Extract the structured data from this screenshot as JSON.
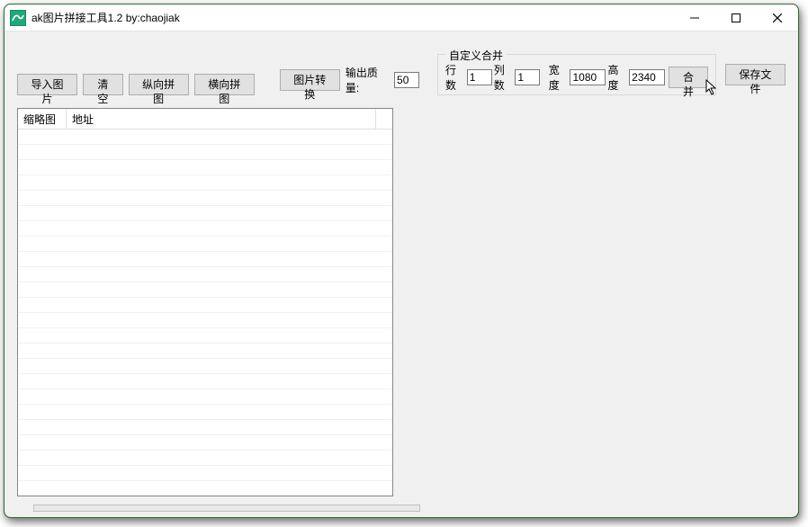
{
  "window": {
    "title": "ak图片拼接工具1.2  by:chaojiak"
  },
  "toolbar": {
    "import_label": "导入图片",
    "clear_label": "清空",
    "vstitch_label": "纵向拼图",
    "hstitch_label": "横向拼图",
    "convert_label": "图片转换",
    "quality_label": "输出质量:",
    "quality_value": "50"
  },
  "custom_merge": {
    "group_title": "自定义合并",
    "rows_label": "行数",
    "rows_value": "1",
    "cols_label": "列数",
    "cols_value": "1",
    "width_label": "宽度",
    "width_value": "1080",
    "height_label": "高度",
    "height_value": "2340",
    "merge_label": "合并"
  },
  "save": {
    "label": "保存文件"
  },
  "list": {
    "col_thumb": "缩略图",
    "col_path": "地址"
  }
}
